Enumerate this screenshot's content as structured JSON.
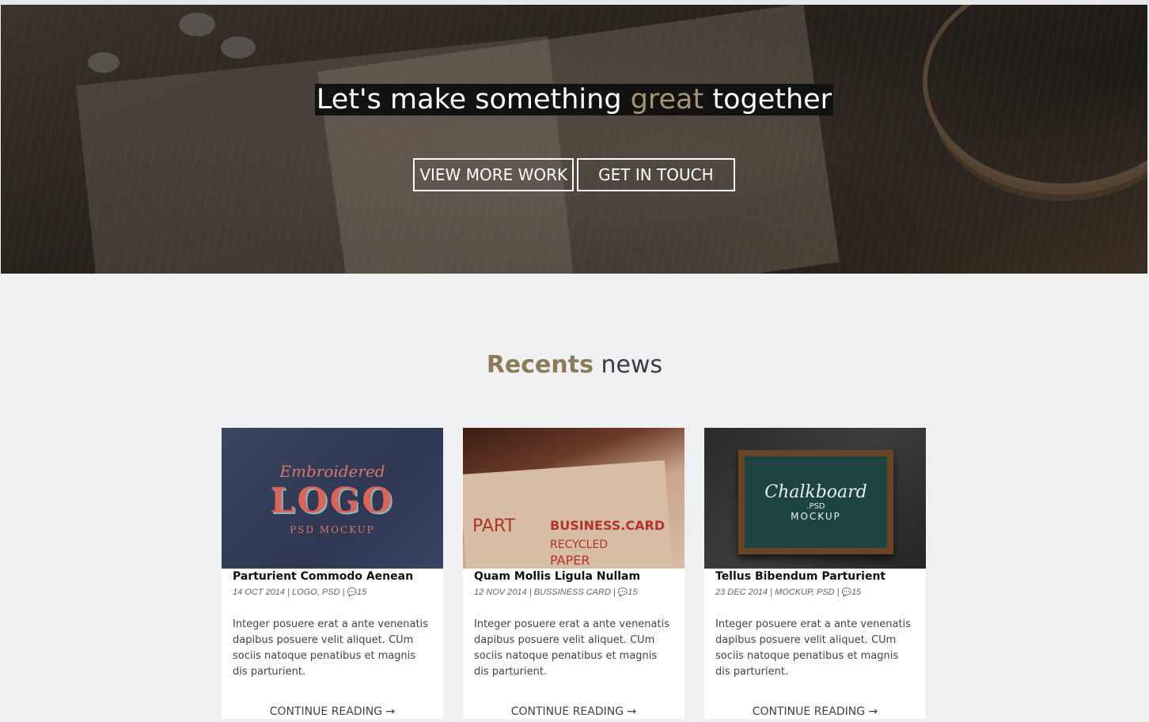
{
  "hero": {
    "title_pre": "Let's make something ",
    "title_accent": "great",
    "title_post": " together",
    "buttons": {
      "view_more_work": "VIEW MORE WORK",
      "get_in_touch": "GET IN TOUCH"
    }
  },
  "news": {
    "title_accent": "Recents",
    "title_rest": " news",
    "cards": [
      {
        "image_text": [
          "Embroidered",
          "LOGO",
          "PSD MOCKUP"
        ],
        "title": "Parturient Commodo Aenean",
        "date": "14 OCT 2014",
        "categories": "LOGO, PSD",
        "comments": "15",
        "body": "Integer posuere erat a ante venenatis dapibus posuere velit aliquet. CUm sociis natoque penatibus et magnis dis parturient.",
        "more": "CONTINUE READING →"
      },
      {
        "image_text": [
          "PART",
          "BUSINESS.CARD",
          "RECYCLED",
          "PAPER"
        ],
        "title": "Quam Mollis Ligula Nullam",
        "date": "12 NOV 2014",
        "categories": "BUSSINESS CARD",
        "comments": "15",
        "body": "Integer posuere erat a ante venenatis dapibus posuere velit aliquet. CUm sociis natoque penatibus et magnis dis parturient.",
        "more": "CONTINUE READING →"
      },
      {
        "image_text": [
          "Chalkboard",
          ".PSD",
          "MOCKUP"
        ],
        "title": "Tellus Bibendum Parturient",
        "date": "23 DEC 2014",
        "categories": "MOCKUP, PSD",
        "comments": "15",
        "body": "Integer posuere erat a ante venenatis dapibus posuere velit aliquet. CUm sociis natoque penatibus et magnis dis parturient.",
        "more": "CONTINUE READING →"
      }
    ]
  },
  "colors": {
    "accent": "#8b7b58",
    "hero_accent": "#a39478",
    "page_bg": "#eff0f2"
  },
  "icons": {
    "comments": "comment-icon"
  }
}
